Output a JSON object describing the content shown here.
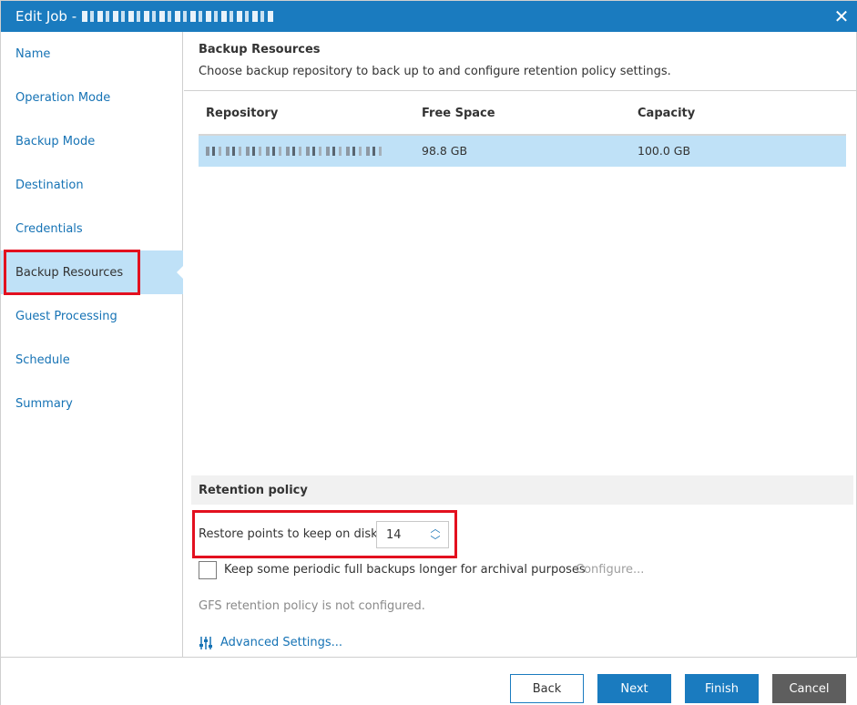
{
  "window": {
    "title": "Edit Job - ",
    "close_icon": "close-icon"
  },
  "sidebar": {
    "items": [
      {
        "label": "Name"
      },
      {
        "label": "Operation Mode"
      },
      {
        "label": "Backup Mode"
      },
      {
        "label": "Destination"
      },
      {
        "label": "Credentials"
      },
      {
        "label": "Backup Resources",
        "active": true
      },
      {
        "label": "Guest Processing"
      },
      {
        "label": "Schedule"
      },
      {
        "label": "Summary"
      }
    ]
  },
  "main": {
    "title": "Backup Resources",
    "description": "Choose backup repository to back up to and configure retention policy settings.",
    "table": {
      "columns": [
        "Repository",
        "Free Space",
        "Capacity"
      ],
      "rows": [
        {
          "repository": "",
          "free_space": "98.8 GB",
          "capacity": "100.0 GB",
          "selected": true
        }
      ]
    },
    "retention": {
      "header": "Retention policy",
      "restore_points_label": "Restore points to keep on disk:",
      "restore_points_value": "14",
      "gfs_checkbox_label": "Keep some periodic full backups longer for archival purposes",
      "gfs_checked": false,
      "configure_label": "Configure...",
      "gfs_status": "GFS retention policy is not configured."
    },
    "advanced_settings_label": "Advanced Settings..."
  },
  "footer": {
    "back_label": "Back",
    "next_label": "Next",
    "finish_label": "Finish",
    "cancel_label": "Cancel"
  },
  "colors": {
    "accent": "#1a7bbf",
    "selection": "#bfe1f7",
    "highlight": "#e3101f",
    "cancel": "#5e5e5e"
  }
}
